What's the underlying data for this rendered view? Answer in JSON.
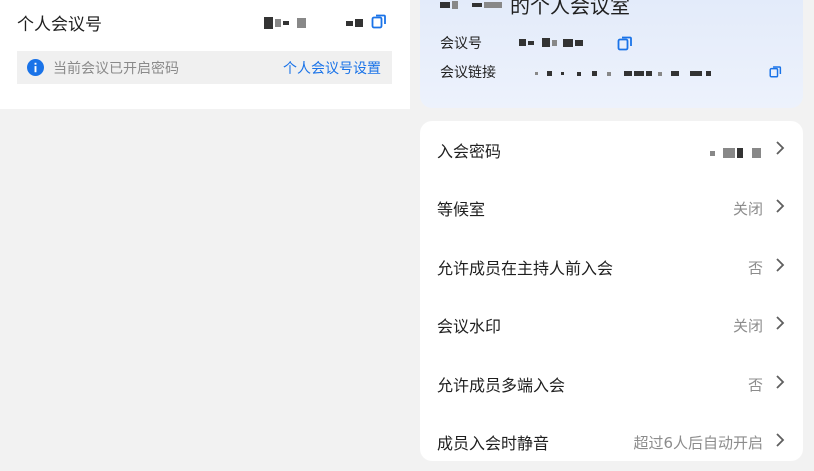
{
  "left": {
    "title": "个人会议号",
    "notice": "当前会议已开启密码",
    "notice_link": "个人会议号设置"
  },
  "room": {
    "title_suffix": "的个人会议室",
    "meeting_id_label": "会议号",
    "meeting_link_label": "会议链接"
  },
  "settings": [
    {
      "label": "入会密码",
      "value": ""
    },
    {
      "label": "等候室",
      "value": "关闭"
    },
    {
      "label": "允许成员在主持人前入会",
      "value": "否"
    },
    {
      "label": "会议水印",
      "value": "关闭"
    },
    {
      "label": "允许成员多端入会",
      "value": "否"
    },
    {
      "label": "成员入会时静音",
      "value": "超过6人后自动开启"
    }
  ],
  "colors": {
    "accent": "#1a73e8",
    "muted": "#8c8c8c"
  },
  "icons": [
    "copy-icon",
    "info-icon",
    "chevron-right-icon"
  ]
}
